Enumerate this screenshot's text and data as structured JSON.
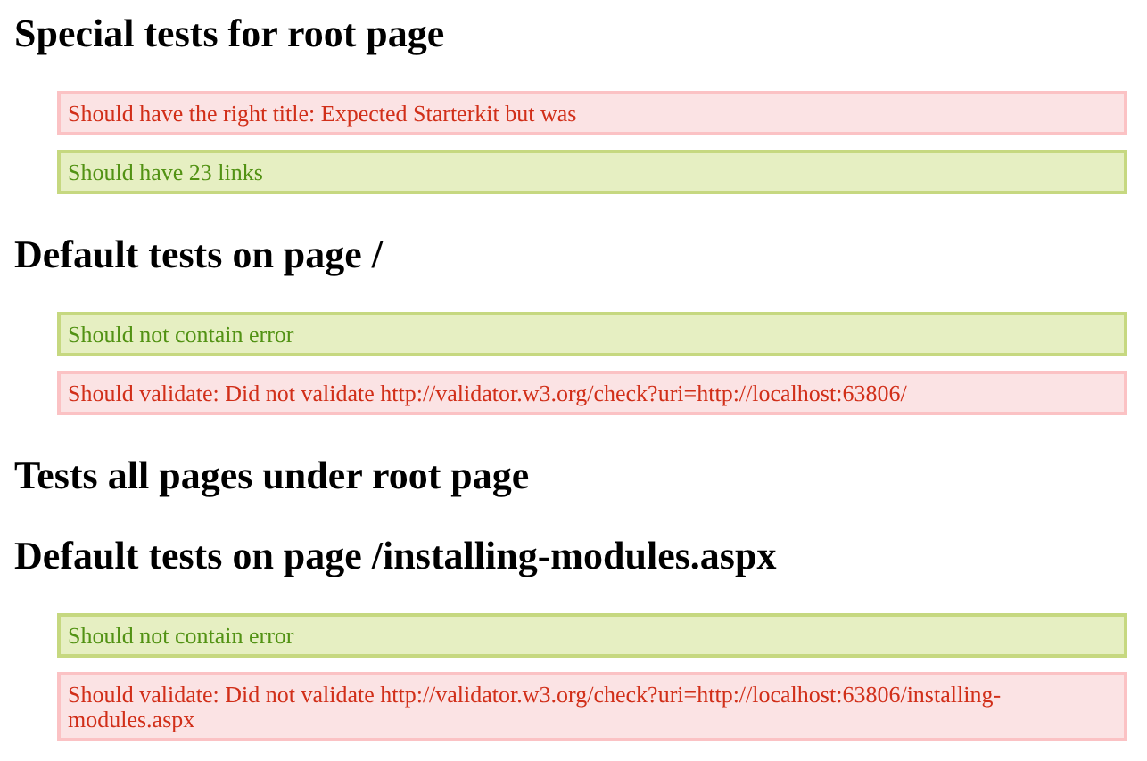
{
  "sections": [
    {
      "title": "Special tests for root page",
      "results": [
        {
          "text": "Should have the right title: Expected Starterkit but was",
          "passed": false
        },
        {
          "text": "Should have 23 links",
          "passed": true
        }
      ]
    },
    {
      "title": "Default tests on page /",
      "results": [
        {
          "text": "Should not contain error",
          "passed": true
        },
        {
          "text": "Should validate: Did not validate http://validator.w3.org/check?uri=http://localhost:63806/",
          "passed": false
        }
      ]
    },
    {
      "title": "Tests all pages under root page"
    },
    {
      "title": "Default tests on page /installing-modules.aspx",
      "results": [
        {
          "text": "Should not contain error",
          "passed": true
        },
        {
          "text": "Should validate: Did not validate http://validator.w3.org/check?uri=http://localhost:63806/installing-modules.aspx",
          "passed": false
        }
      ]
    }
  ]
}
